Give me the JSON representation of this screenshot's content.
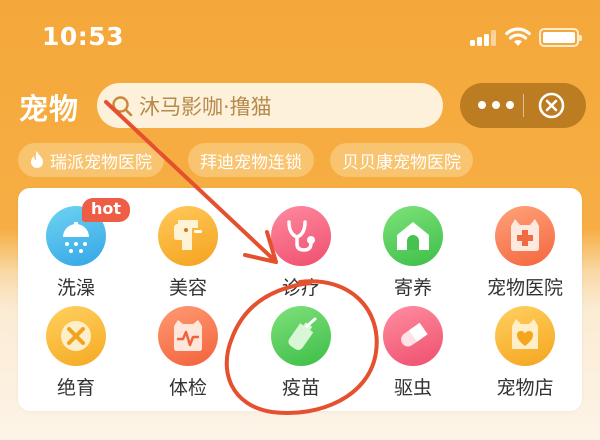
{
  "status_bar": {
    "time": "10:53"
  },
  "header": {
    "title": "宠物",
    "search_text": "沐马影咖·撸猫"
  },
  "chips": [
    {
      "label": "瑞派宠物医院",
      "icon": "flame-icon"
    },
    {
      "label": "拜迪宠物连锁"
    },
    {
      "label": "贝贝康宠物医院"
    }
  ],
  "categories": [
    {
      "label": "洗澡",
      "icon": "shower-icon",
      "badge": "hot"
    },
    {
      "label": "美容",
      "icon": "dog-grooming-icon"
    },
    {
      "label": "诊疗",
      "icon": "stethoscope-icon"
    },
    {
      "label": "寄养",
      "icon": "pet-house-icon"
    },
    {
      "label": "宠物医院",
      "icon": "hospital-icon"
    },
    {
      "label": "绝育",
      "icon": "sterilize-icon"
    },
    {
      "label": "体检",
      "icon": "checkup-icon"
    },
    {
      "label": "疫苗",
      "icon": "vaccine-icon"
    },
    {
      "label": "驱虫",
      "icon": "pill-icon"
    },
    {
      "label": "宠物店",
      "icon": "pet-store-icon"
    }
  ],
  "colors": {
    "header_bg": "#F5A83A",
    "annotation": "#E5502E"
  }
}
